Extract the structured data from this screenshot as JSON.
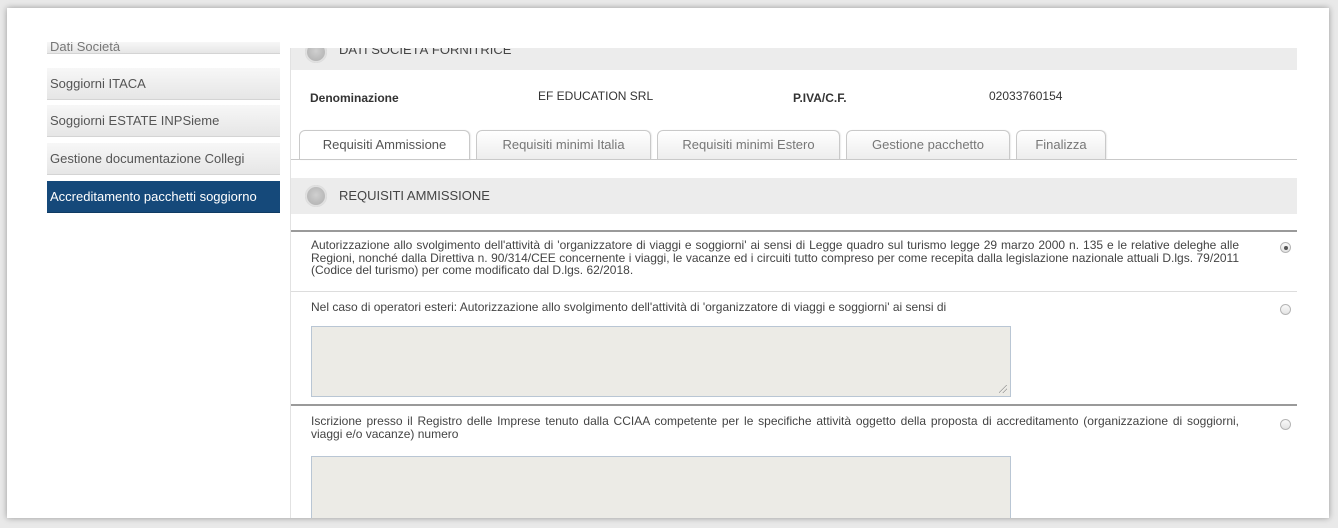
{
  "sidebar": {
    "items": [
      {
        "label": "Dati Società"
      },
      {
        "label": "Soggiorni ITACA"
      },
      {
        "label": "Soggiorni ESTATE INPSieme"
      },
      {
        "label": "Gestione documentazione Collegi"
      },
      {
        "label": "Accreditamento pacchetti soggiorno",
        "active": true
      }
    ]
  },
  "company_section": {
    "title": "DATI SOCIETÀ FORNITRICE",
    "denominazione_label": "Denominazione",
    "denominazione_value": "EF EDUCATION SRL",
    "piva_label": "P.IVA/C.F.",
    "piva_value": "02033760154"
  },
  "tabs": [
    {
      "label": "Requisiti Ammissione",
      "active": true
    },
    {
      "label": "Requisiti minimi Italia"
    },
    {
      "label": "Requisiti minimi Estero"
    },
    {
      "label": "Gestione pacchetto"
    },
    {
      "label": "Finalizza"
    }
  ],
  "requisiti": {
    "title": "REQUISITI AMMISSIONE",
    "items": [
      {
        "text": "Autorizzazione allo svolgimento dell'attività di 'organizzatore di viaggi e soggiorni' ai sensi di Legge quadro sul turismo legge 29 marzo 2000 n. 135 e le relative deleghe alle Regioni, nonché dalla Direttiva n. 90/314/CEE concernente i viaggi, le vacanze ed i circuiti tutto compreso per come recepita dalla legislazione nazionale attuali D.lgs. 79/2011 (Codice del turismo) per come modificato dal D.lgs. 62/2018.",
        "selected": true
      },
      {
        "text": "Nel caso di operatori esteri: Autorizzazione allo svolgimento dell'attività di 'organizzatore di viaggi e soggiorni' ai sensi di",
        "selected": false,
        "textarea_value": ""
      },
      {
        "text": "Iscrizione presso il Registro delle Imprese tenuto dalla CCIAA competente per le specifiche attività oggetto della proposta di accreditamento (organizzazione di soggiorni, viaggi e/o vacanze) numero",
        "selected": false,
        "textarea_value": ""
      }
    ]
  }
}
